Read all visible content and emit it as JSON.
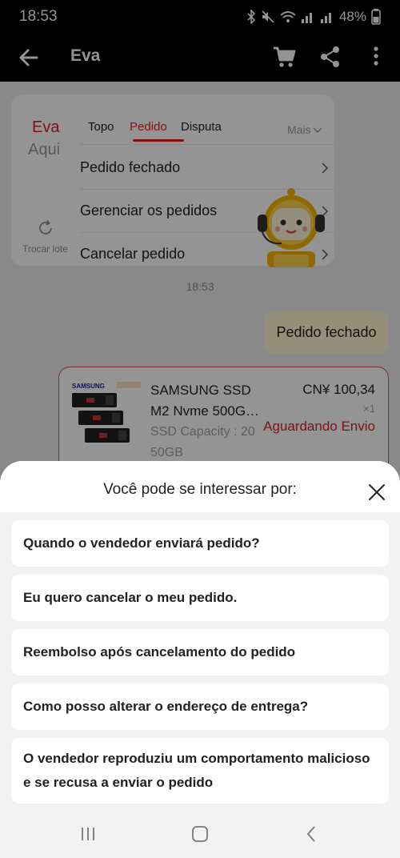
{
  "status_bar": {
    "time": "18:53",
    "battery": "48%"
  },
  "app_bar": {
    "title": "Eva",
    "icons": [
      "back-arrow-icon",
      "cart-icon",
      "share-icon",
      "more-vertical-icon"
    ]
  },
  "bot_card": {
    "name": "Eva",
    "subtitle": "Aqui",
    "refresh_label": "Trocar lote",
    "tabs": [
      "Topo",
      "Pedido",
      "Disputa"
    ],
    "active_tab": "Pedido",
    "more_label": "Mais",
    "rows": [
      "Pedido fechado",
      "Gerenciar os pedidos",
      "Cancelar pedido"
    ]
  },
  "chat": {
    "timestamp": "18:53",
    "user_message": "Pedido fechado"
  },
  "order": {
    "title": "SAMSUNG SSD M2 Nvme 500G…",
    "variant": "SSD Capacity : 20 50GB",
    "price": "CN¥ 100,34",
    "quantity": "×1",
    "status": "Aguardando Envio"
  },
  "sheet": {
    "title": "Você pode se interessar por:",
    "questions": [
      "Quando o vendedor enviará pedido?",
      "Eu quero cancelar o meu pedido.",
      "Reembolso após cancelamento do pedido",
      "Como posso alterar o endereço de entrega?",
      "O vendedor reproduziu um comportamento malicioso e se recusa a enviar o pedido"
    ]
  },
  "colors": {
    "accent": "#e02020",
    "bubble": "#fff6d0",
    "overlay": "rgba(0,0,0,0.42)"
  }
}
